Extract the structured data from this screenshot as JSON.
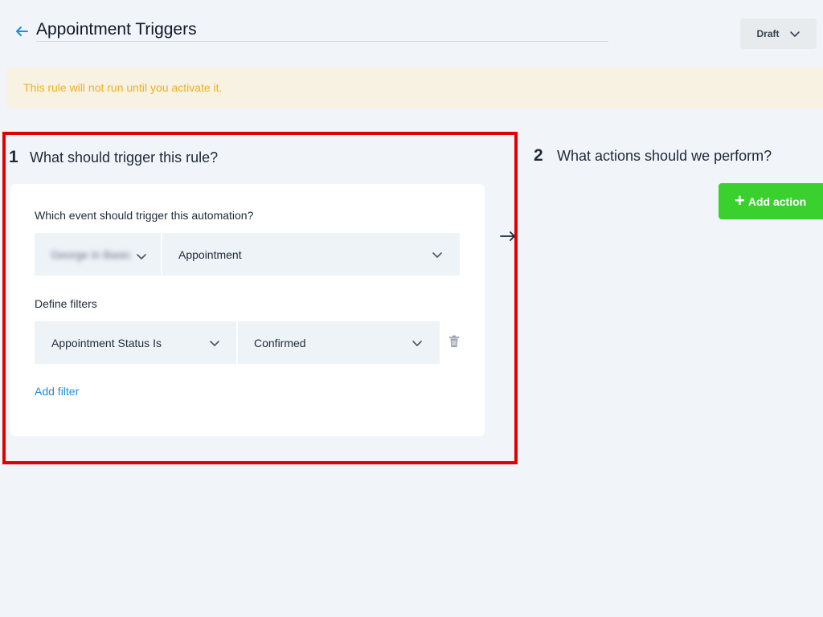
{
  "header": {
    "title": "Appointment Triggers",
    "status": "Draft"
  },
  "banner": {
    "text": "This rule will not run until you activate it."
  },
  "trigger": {
    "step_number": "1",
    "title": "What should trigger this rule?",
    "event_label": "Which event should trigger this automation?",
    "source_value": "George in Basic",
    "event_value": "Appointment",
    "filters_label": "Define filters",
    "filter_field": "Appointment Status Is",
    "filter_value": "Confirmed",
    "add_filter": "Add filter"
  },
  "actions": {
    "step_number": "2",
    "title": "What actions should we perform?",
    "add_action": "Add action"
  },
  "colors": {
    "accent_blue": "#1d8de0",
    "warning_text": "#f2b01e",
    "highlight_border": "#e00000",
    "add_action_green": "#3ad12f"
  },
  "icons": [
    "back-arrow-icon",
    "chevron-down-icon",
    "trash-icon",
    "arrow-right-icon",
    "plus-icon"
  ]
}
